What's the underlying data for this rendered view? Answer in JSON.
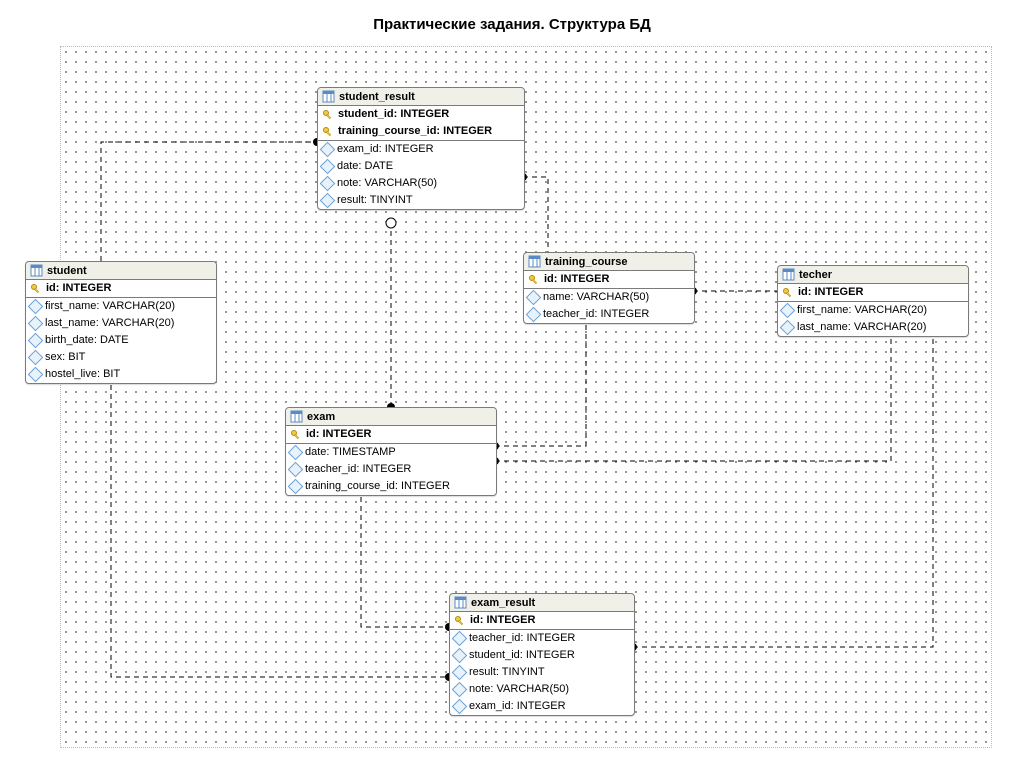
{
  "title": "Практические задания. Структура БД",
  "entities": {
    "student_result": {
      "name": "student_result",
      "keys": [
        "student_id: INTEGER",
        "training_course_id: INTEGER"
      ],
      "cols": [
        "exam_id: INTEGER",
        "date: DATE",
        "note: VARCHAR(50)",
        "result: TINYINT"
      ]
    },
    "student": {
      "name": "student",
      "keys": [
        "id: INTEGER"
      ],
      "cols": [
        "first_name: VARCHAR(20)",
        "last_name: VARCHAR(20)",
        "birth_date: DATE",
        "sex: BIT",
        "hostel_live: BIT"
      ]
    },
    "training_course": {
      "name": "training_course",
      "keys": [
        "id: INTEGER"
      ],
      "cols": [
        "name: VARCHAR(50)",
        "teacher_id: INTEGER"
      ]
    },
    "techer": {
      "name": "techer",
      "keys": [
        "id: INTEGER"
      ],
      "cols": [
        "first_name: VARCHAR(20)",
        "last_name: VARCHAR(20)"
      ]
    },
    "exam": {
      "name": "exam",
      "keys": [
        "id: INTEGER"
      ],
      "cols": [
        "date: TIMESTAMP",
        "teacher_id: INTEGER",
        "training_course_id: INTEGER"
      ]
    },
    "exam_result": {
      "name": "exam_result",
      "keys": [
        "id: INTEGER"
      ],
      "cols": [
        "teacher_id: INTEGER",
        "student_id: INTEGER",
        "result: TINYINT",
        "note: VARCHAR(50)",
        "exam_id: INTEGER"
      ]
    }
  }
}
